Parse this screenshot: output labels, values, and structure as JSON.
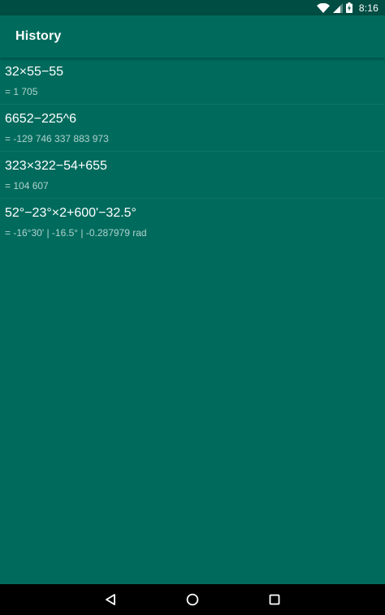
{
  "status_bar": {
    "time": "8:16",
    "icons": [
      "wifi-icon",
      "signal-icon",
      "battery-charging-icon"
    ]
  },
  "app_bar": {
    "title": "History"
  },
  "history": [
    {
      "expression": "32×55−55",
      "result": "= 1 705"
    },
    {
      "expression": "6652−225^6",
      "result": "= -129 746 337 883 973"
    },
    {
      "expression": "323×322−54+655",
      "result": "= 104 607"
    },
    {
      "expression": "52°−23°×2+600'−32.5°",
      "result": "= -16°30' | -16.5° | -0.287979 rad"
    }
  ],
  "nav_bar": {
    "icons": [
      "back-icon",
      "home-icon",
      "recents-icon"
    ]
  },
  "colors": {
    "background": "#006b5d",
    "status_bar": "#004d43",
    "text_primary": "#ffffff",
    "text_secondary": "#cfe3df"
  }
}
